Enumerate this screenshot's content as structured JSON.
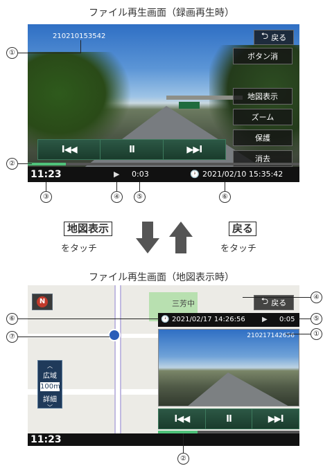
{
  "captions": {
    "top": "ファイル再生画面（録画再生時）",
    "bottom": "ファイル再生画面（地図表示時）"
  },
  "screen1": {
    "file_id": "210210153542",
    "back_label": "戻る",
    "buttons": {
      "hide_buttons": "ボタン消",
      "map_display": "地図表示",
      "zoom": "ズーム",
      "protect": "保護",
      "delete": "消去"
    },
    "controls": {
      "prev": "I◀◀",
      "pause": "II",
      "next": "▶▶I"
    },
    "status": {
      "clock": "11:23",
      "play_icon": "play-icon",
      "elapsed": "0:03",
      "record_datetime": "2021/02/10 15:35:42"
    },
    "progress": 0.14
  },
  "middle": {
    "left_label": "地図表示",
    "left_sub": "をタッチ",
    "right_label": "戻る",
    "right_sub": "をタッチ"
  },
  "screen2": {
    "map_label_town": "三芳中",
    "compass_icon": "north-compass-icon",
    "back_label": "戻る",
    "record_datetime": "2021/02/17 14:26:56",
    "elapsed": "0:05",
    "file_id": "210217142656",
    "scale": {
      "wide": "広域",
      "value": "100m",
      "detail": "詳細"
    },
    "controls": {
      "prev": "I◀◀",
      "pause": "II",
      "next": "▶▶I"
    },
    "clock": "11:23",
    "progress": 0.28
  },
  "callouts": [
    "①",
    "②",
    "③",
    "④",
    "⑤",
    "⑥",
    "⑦"
  ],
  "colors": {
    "control_green": "#2c5845",
    "progress_green": "#4fc27a",
    "status_bar": "#111111",
    "map_bg": "#ecebe6"
  }
}
